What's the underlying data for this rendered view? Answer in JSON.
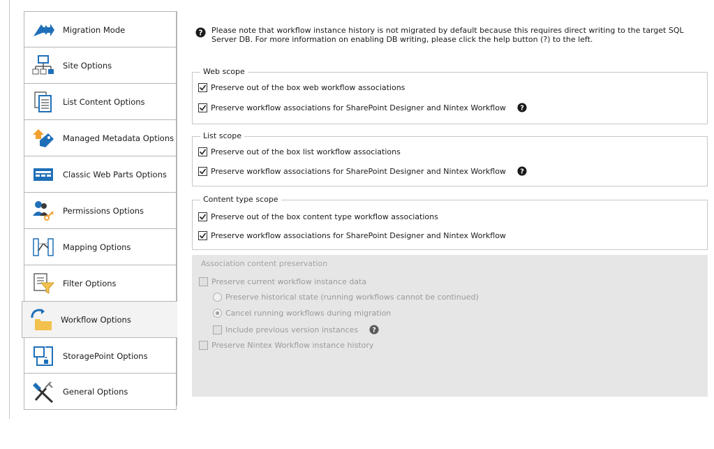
{
  "tabs": [
    {
      "label": "Migration Mode",
      "icon": "migration-arrow-icon"
    },
    {
      "label": "Site Options",
      "icon": "site-tree-icon"
    },
    {
      "label": "List Content Options",
      "icon": "list-document-icon"
    },
    {
      "label": "Managed Metadata Options",
      "icon": "metadata-tag-icon"
    },
    {
      "label": "Classic Web Parts Options",
      "icon": "web-parts-icon"
    },
    {
      "label": "Permissions Options",
      "icon": "permissions-key-icon"
    },
    {
      "label": "Mapping Options",
      "icon": "mapping-icon"
    },
    {
      "label": "Filter Options",
      "icon": "filter-icon"
    },
    {
      "label": "Workflow Options",
      "icon": "workflow-folder-icon"
    },
    {
      "label": "StoragePoint Options",
      "icon": "storagepoint-icon"
    },
    {
      "label": "General Options",
      "icon": "tools-icon"
    }
  ],
  "active_tab": "Workflow Options",
  "note": "Please note that workflow instance history is not migrated by default because this requires direct writing to the target SQL Server DB. For more information on enabling DB writing, please click the help button (?) to the left.",
  "web_scope": {
    "title": "Web scope",
    "ootb_label": "Preserve out of the box web workflow associations",
    "ootb_checked": true,
    "spd_label": "Preserve workflow associations for SharePoint Designer and Nintex Workflow",
    "spd_checked": true
  },
  "list_scope": {
    "title": "List scope",
    "ootb_label": "Preserve out of the box list workflow associations",
    "ootb_checked": true,
    "spd_label": "Preserve workflow associations for SharePoint Designer and Nintex Workflow",
    "spd_checked": true
  },
  "content_type_scope": {
    "title": "Content type scope",
    "ootb_label": "Preserve out of the box content type workflow associations",
    "ootb_checked": true,
    "spd_label": "Preserve workflow associations for SharePoint Designer and Nintex Workflow",
    "spd_checked": true
  },
  "association": {
    "title": "Association content preservation",
    "preserve_instance_label": "Preserve current workflow instance data",
    "historical_label": "Preserve historical state (running workflows cannot be continued)",
    "cancel_label": "Cancel running workflows during migration",
    "selected_radio": "cancel",
    "include_versions_label": "Include previous version instances",
    "nintex_history_label": "Preserve Nintex Workflow instance history"
  },
  "colors": {
    "accent_blue": "#1f6fb8",
    "folder_yellow": "#f2c14e",
    "tag_orange": "#f0a030",
    "disabled_bg": "#e6e6e6"
  }
}
